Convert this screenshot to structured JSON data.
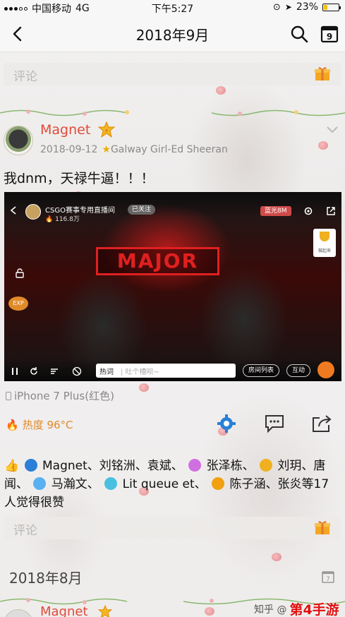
{
  "status_bar": {
    "carrier": "中国移动",
    "network": "4G",
    "time": "下午5:27",
    "battery": "23%",
    "battery_level": 0.23
  },
  "nav": {
    "title": "2018年9月",
    "back_icon": "chevron-left-icon",
    "search_icon": "search-icon",
    "calendar_icon": "calendar-icon",
    "calendar_day": "9"
  },
  "comment_bar": {
    "placeholder": "评论"
  },
  "post": {
    "username": "Magnet",
    "date": "2018-09-12",
    "song": "Galway Girl-Ed Sheeran",
    "text": "我dnm，天禄牛逼！！！",
    "video": {
      "channel": "CSGO赛事专用直播间",
      "heat": "116.8万",
      "follow": "已关注",
      "quality": "蓝光8M",
      "banner": "MAJOR",
      "exp": "EXP",
      "trophy_caption": "做起来",
      "danmu_label": "热词",
      "danmu_placeholder": "| 吐个槽呗~",
      "room_list": "房间列表",
      "interact": "互动"
    },
    "device": "iPhone 7 Plus(红色)",
    "heat": "热度 96°C",
    "likes_text_1": "Magnet、刘铭洲、袁斌、",
    "likes_text_2": "张泽栋、",
    "likes_text_3": "刘玥、唐闻",
    "likes_text_4": "、",
    "likes_text_5": "马瀚文、",
    "likes_text_6": "Lit queue et、",
    "likes_text_7": "陈子涵、张炎等17人觉得很赞"
  },
  "comment_bar_2": {
    "placeholder": "评论"
  },
  "next_month": {
    "label": "2018年8月"
  },
  "next_post": {
    "username": "Magnet"
  },
  "watermark": {
    "site": "知乎 @",
    "brand": "第4手游"
  },
  "colors": {
    "username": "#e04a3a",
    "heat": "#e08a2a",
    "accent_blue": "#2a7fd8"
  }
}
